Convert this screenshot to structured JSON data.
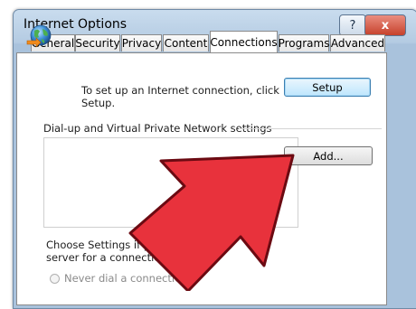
{
  "window": {
    "title": "Internet Options",
    "help_label": "?",
    "close_label": "x"
  },
  "tabs": [
    {
      "label": "General"
    },
    {
      "label": "Security"
    },
    {
      "label": "Privacy"
    },
    {
      "label": "Content"
    },
    {
      "label": "Connections",
      "active": true
    },
    {
      "label": "Programs"
    },
    {
      "label": "Advanced"
    }
  ],
  "connections": {
    "setup_text_line1": "To set up an Internet connection, click",
    "setup_text_line2": "Setup.",
    "setup_button": "Setup",
    "dialup_heading": "Dial-up and Virtual Private Network settings",
    "add_button": "Add...",
    "settings_text_line1": "Choose Settings if you need to",
    "settings_text_line2": "server for a connection.",
    "never_dial_label": "Never dial a connection"
  },
  "overlay": {
    "arrow_color": "#e8323c",
    "arrow_icon": "red-arrow-icon"
  },
  "colors": {
    "title_bar": "#b4cbe2",
    "close_button": "#c6412b",
    "focused_button": "#bee6fd"
  }
}
